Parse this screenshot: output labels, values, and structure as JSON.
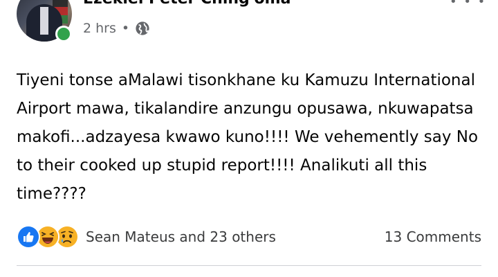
{
  "post": {
    "author": "Ezekiel Peter Ching'oma",
    "time": "2 hrs",
    "separator": "•",
    "privacy_icon": "globe-icon",
    "more_icon": "more-options-icon",
    "text": "Tiyeni tonse aMalawi tisonkhane ku Kamuzu International Airport mawa, tikalandire anzungu opusawa, nkuwapatsa makofi...adzayesa kwawo kuno!!!! We vehemently say No to their cooked up stupid report!!!! Analikuti all this time????"
  },
  "engagement": {
    "reactions": [
      "like-icon",
      "haha-icon",
      "sad-icon"
    ],
    "reactors_label": "Sean Mateus and 23 others",
    "comments_label": "13 Comments"
  },
  "colors": {
    "online": "#31a24c",
    "like": "#1877f2",
    "emoji": "#f7b125",
    "secondary_text": "#65676b"
  }
}
